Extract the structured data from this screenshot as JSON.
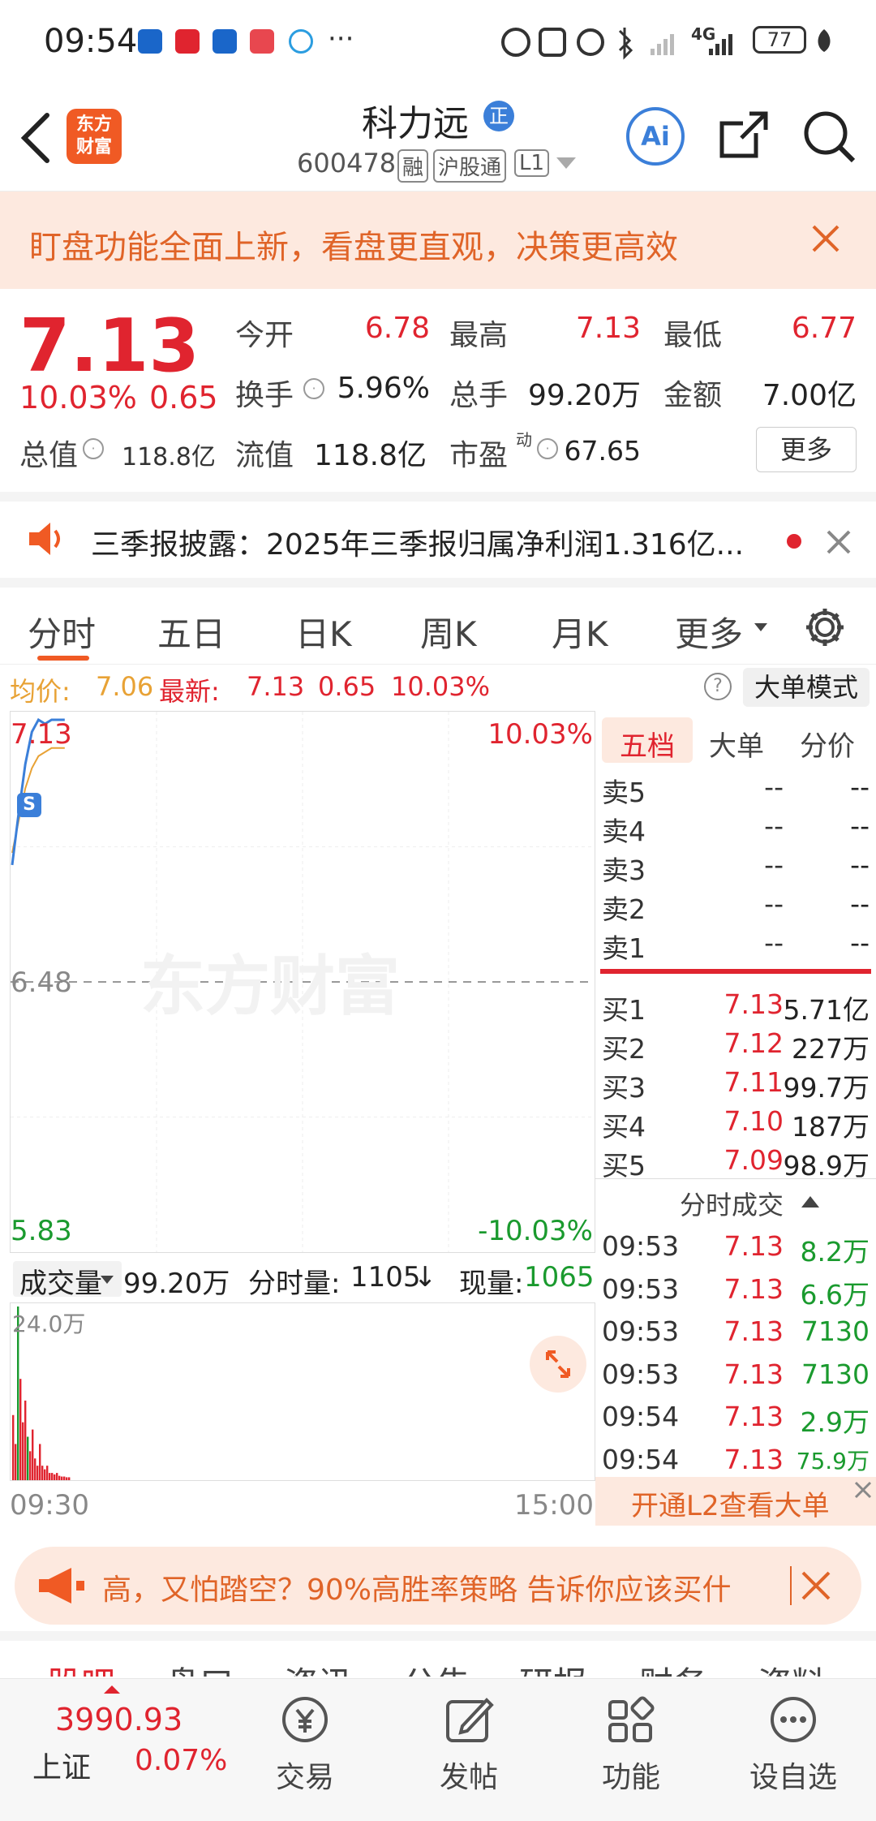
{
  "status_bar": {
    "time": "09:54",
    "more": "···",
    "network": "4G",
    "battery": "77"
  },
  "header": {
    "logo_text_top": "东方",
    "logo_text_bottom": "财富",
    "stock_name": "科力远",
    "badge": "正",
    "stock_code": "600478",
    "tags": [
      "融",
      "沪股通",
      "L1"
    ],
    "ai_label": "Ai"
  },
  "banner": {
    "text": "盯盘功能全面上新，看盘更直观，决策更高效"
  },
  "quote": {
    "price": "7.13",
    "change_pct": "10.03%",
    "change": "0.65",
    "market_cap_label": "总值",
    "market_cap": "118.8亿",
    "open_label": "今开",
    "open": "6.78",
    "high_label": "最高",
    "high": "7.13",
    "low_label": "最低",
    "low": "6.77",
    "turnover_label": "换手",
    "turnover": "5.96%",
    "volume_label": "总手",
    "volume": "99.20万",
    "amount_label": "金额",
    "amount": "7.00亿",
    "float_label": "流值",
    "float_cap": "118.8亿",
    "pe_label": "市盈",
    "pe_sup": "动",
    "pe": "67.65",
    "more_button": "更多"
  },
  "news": {
    "text": "三季报披露：2025年三季报归属净利润1.316亿..."
  },
  "tabs": [
    "分时",
    "五日",
    "日K",
    "周K",
    "月K",
    "更多"
  ],
  "active_tab": "分时",
  "chart_info": {
    "avg_label": "均价:",
    "avg": "7.06",
    "latest_label": "最新:",
    "latest": "7.13",
    "change": "0.65",
    "pct": "10.03%",
    "help": "?",
    "mode_button": "大单模式"
  },
  "chart_data": {
    "type": "line",
    "y_top_label": "7.13",
    "y_mid_label": "6.48",
    "y_bottom_label": "5.83",
    "right_top_label": "10.03%",
    "right_bottom_label": "-10.03%",
    "ylim": [
      5.83,
      7.13
    ],
    "prev_close": 6.48,
    "watermark": "东方财富",
    "s_marker": "S",
    "price_series": [
      6.77,
      6.9,
      7.02,
      7.1,
      7.13,
      7.12,
      7.13,
      7.13,
      7.13
    ],
    "avg_series": [
      6.8,
      6.88,
      6.96,
      7.01,
      7.04,
      7.05,
      7.06,
      7.06,
      7.06
    ],
    "time_start": "09:30",
    "time_end": "15:00",
    "volume": {
      "max_label": "24.0万",
      "bars": [
        {
          "v": 9,
          "c": "red"
        },
        {
          "v": 5,
          "c": "red"
        },
        {
          "v": 24,
          "c": "green"
        },
        {
          "v": 14,
          "c": "red"
        },
        {
          "v": 8,
          "c": "red"
        },
        {
          "v": 11,
          "c": "red"
        },
        {
          "v": 6,
          "c": "green"
        },
        {
          "v": 4,
          "c": "red"
        },
        {
          "v": 7,
          "c": "red"
        },
        {
          "v": 3,
          "c": "red"
        },
        {
          "v": 2,
          "c": "red"
        },
        {
          "v": 5,
          "c": "red"
        },
        {
          "v": 2,
          "c": "red"
        },
        {
          "v": 1.5,
          "c": "red"
        },
        {
          "v": 2,
          "c": "red"
        },
        {
          "v": 1,
          "c": "red"
        },
        {
          "v": 1,
          "c": "red"
        },
        {
          "v": 0.8,
          "c": "red"
        },
        {
          "v": 1,
          "c": "red"
        },
        {
          "v": 0.6,
          "c": "red"
        },
        {
          "v": 0.5,
          "c": "red"
        },
        {
          "v": 0.5,
          "c": "red"
        },
        {
          "v": 0.4,
          "c": "red"
        },
        {
          "v": 0.4,
          "c": "red"
        }
      ]
    }
  },
  "volume_bar": {
    "select_label": "成交量",
    "total": "99.20万",
    "minute_label": "分时量:",
    "minute": "1105",
    "arrow": "↓",
    "current_label": "现量:",
    "current": "1065"
  },
  "order_book": {
    "tabs": [
      "五档",
      "大单",
      "分价"
    ],
    "asks": [
      {
        "label": "卖5",
        "price": "--",
        "vol": "--"
      },
      {
        "label": "卖4",
        "price": "--",
        "vol": "--"
      },
      {
        "label": "卖3",
        "price": "--",
        "vol": "--"
      },
      {
        "label": "卖2",
        "price": "--",
        "vol": "--"
      },
      {
        "label": "卖1",
        "price": "--",
        "vol": "--"
      }
    ],
    "bids": [
      {
        "label": "买1",
        "price": "7.13",
        "vol": "5.71亿"
      },
      {
        "label": "买2",
        "price": "7.12",
        "vol": "227万"
      },
      {
        "label": "买3",
        "price": "7.11",
        "vol": "99.7万"
      },
      {
        "label": "买4",
        "price": "7.10",
        "vol": "187万"
      },
      {
        "label": "买5",
        "price": "7.09",
        "vol": "98.9万"
      }
    ],
    "ticks_title": "分时成交",
    "ticks": [
      {
        "time": "09:53",
        "price": "7.13",
        "vol": "8.2万"
      },
      {
        "time": "09:53",
        "price": "7.13",
        "vol": "6.6万"
      },
      {
        "time": "09:53",
        "price": "7.13",
        "vol": "7130"
      },
      {
        "time": "09:53",
        "price": "7.13",
        "vol": "7130"
      },
      {
        "time": "09:54",
        "price": "7.13",
        "vol": "2.9万"
      },
      {
        "time": "09:54",
        "price": "7.13",
        "vol": "75.9万"
      }
    ],
    "l2_button": "开通L2查看大单"
  },
  "ad": {
    "text": "高，又怕踏空？90%高胜率策略 告诉你应该买什"
  },
  "sub_tabs": [
    "股吧",
    "盘口",
    "资讯",
    "公告",
    "研报",
    "财务",
    "资料"
  ],
  "bottom_nav": {
    "index_value": "3990.93",
    "index_name": "上证",
    "index_pct": "0.07%",
    "items": [
      {
        "label": "交易",
        "icon": "yen-exchange-icon"
      },
      {
        "label": "发帖",
        "icon": "edit-icon"
      },
      {
        "label": "功能",
        "icon": "grid-icon"
      },
      {
        "label": "设自选",
        "icon": "more-dots-icon"
      }
    ]
  },
  "colors": {
    "up": "#e0242f",
    "down": "#1a9a2e",
    "accent": "#f05a24",
    "avg_line": "#e8a235",
    "price_line": "#3b7fd9"
  }
}
